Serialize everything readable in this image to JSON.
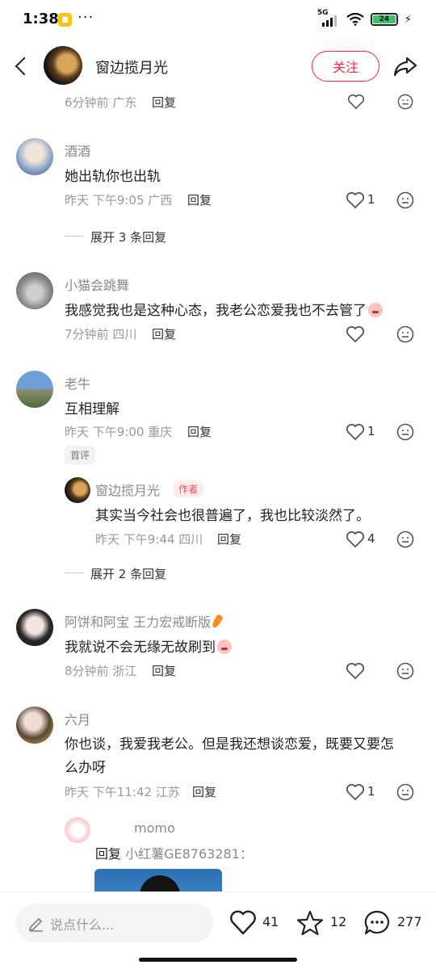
{
  "status_bar": {
    "time": "1:38",
    "dots": "···",
    "network": "5G",
    "battery": "24"
  },
  "header": {
    "title": "窗边揽月光",
    "follow_label": "关注"
  },
  "top_partial": {
    "time": "6分钟前",
    "location": "广东",
    "reply_label": "回复"
  },
  "comments": [
    {
      "user": "酒酒",
      "text": "她出轨你也出轨",
      "time": "昨天",
      "clock": "下午9:05",
      "location": "广西",
      "reply_label": "回复",
      "likes": "1",
      "expand": "展开 3 条回复"
    },
    {
      "user": "小猫会跳舞",
      "text": "我感觉我也是这种心态，我老公恋爱我也不去管了",
      "time": "7分钟前",
      "location": "四川",
      "reply_label": "回复"
    },
    {
      "user": "老牛",
      "text": "互相理解",
      "time": "昨天",
      "clock": "下午9:00",
      "location": "重庆",
      "reply_label": "回复",
      "likes": "1",
      "tag": "首评",
      "reply": {
        "user": "窗边揽月光",
        "author_tag": "作者",
        "text": "其实当今社会也很普遍了，我也比较淡然了。",
        "time": "昨天",
        "clock": "下午9:44",
        "location": "四川",
        "reply_label": "回复",
        "likes": "4"
      },
      "expand": "展开 2 条回复"
    },
    {
      "user": "阿饼和阿宝 王力宏戒断版",
      "text": "我就说不会无缘无故刷到",
      "time": "8分钟前",
      "location": "浙江",
      "reply_label": "回复"
    },
    {
      "user": "六月",
      "text_line1": "你也谈，我爱我老公。但是我还想谈恋爱，既要又要怎",
      "text_line2": "么办呀",
      "time": "昨天",
      "clock": "下午11:42",
      "location": "江苏",
      "reply_label": "回复",
      "likes": "1",
      "reply": {
        "user": "momo",
        "reply_word": "回复",
        "target": "小红薯GE8763281："
      }
    }
  ],
  "bottom_bar": {
    "placeholder": "说点什么...",
    "likes": "41",
    "stars": "12",
    "comments": "277"
  },
  "colors": {
    "accent": "#ff2442",
    "muted": "#999999"
  }
}
